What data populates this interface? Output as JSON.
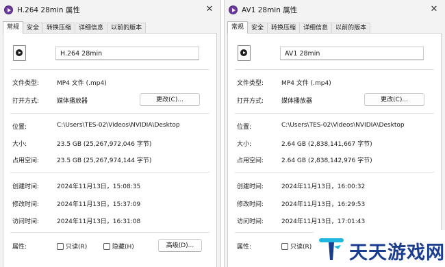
{
  "tabs": [
    "常规",
    "安全",
    "转换压缩",
    "详细信息",
    "以前的版本"
  ],
  "labels": {
    "type": "文件类型:",
    "open_with": "打开方式:",
    "location": "位置:",
    "size": "大小:",
    "size_on_disk": "占用空间:",
    "created": "创建时间:",
    "modified": "修改时间:",
    "accessed": "访问时间:",
    "attributes": "属性:",
    "change_button": "更改(C)...",
    "readonly": "只读(R)",
    "hidden": "隐藏(H)",
    "advanced_button": "高级(D)..."
  },
  "windows": [
    {
      "title": "H.264 28min 属性",
      "filename": "H.264 28min",
      "type": "MP4 文件 (.mp4)",
      "open_with": "媒体播放器",
      "location": "C:\\Users\\TES-02\\Videos\\NVIDIA\\Desktop",
      "size": "23.5 GB (25,267,972,046 字节)",
      "size_on_disk": "23.5 GB (25,267,974,144 字节)",
      "created": "2024年11月13日，15:08:35",
      "modified": "2024年11月13日，15:37:09",
      "accessed": "2024年11月13日，16:31:08"
    },
    {
      "title": "AV1 28min 属性",
      "filename": "AV1 28min",
      "type": "MP4 文件 (.mp4)",
      "open_with": "媒体播放器",
      "location": "C:\\Users\\TES-02\\Videos\\NVIDIA\\Desktop",
      "size": "2.64 GB (2,838,141,667 字节)",
      "size_on_disk": "2.64 GB (2,838,142,976 字节)",
      "created": "2024年11月13日，16:00:32",
      "modified": "2024年11月13日，16:29:53",
      "accessed": "2024年11月13日，17:01:43"
    }
  ],
  "watermark": {
    "text": "天天游戏网",
    "color": "#1a3d8f",
    "accent": "#1fb6e0"
  },
  "icons": {
    "app": "media-player-icon",
    "close": "close-icon",
    "file": "video-file-icon"
  }
}
